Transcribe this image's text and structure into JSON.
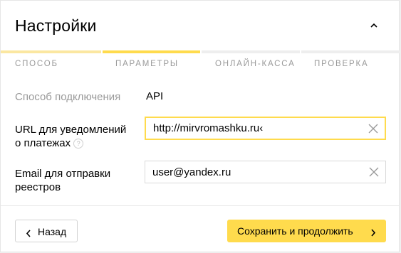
{
  "header": {
    "title": "Настройки",
    "collapse_icon": "chevron-up-icon"
  },
  "steps": [
    {
      "label": "Способ",
      "state": "done",
      "color": "#fbe7a1"
    },
    {
      "label": "Параметры",
      "state": "active",
      "color": "#ffdb4d"
    },
    {
      "label": "Онлайн-касса",
      "state": "pending",
      "color": "#eeeeee"
    },
    {
      "label": "Проверка",
      "state": "pending",
      "color": "#eeeeee"
    }
  ],
  "form": {
    "connection": {
      "label": "Способ подключения",
      "value": "API"
    },
    "notify_url": {
      "label_line1": "URL для уведомлений",
      "label_line2": "о платежах",
      "help": "?",
      "value": "http://mirvromashku.ru‹"
    },
    "email": {
      "label_line1": "Email для отправки",
      "label_line2": "реестров",
      "value": "user@yandex.ru"
    }
  },
  "footer": {
    "back_label": "Назад",
    "submit_label": "Сохранить и продолжить"
  },
  "colors": {
    "accent": "#ffdb4d",
    "muted": "#999999",
    "border": "#d9d9d9"
  }
}
